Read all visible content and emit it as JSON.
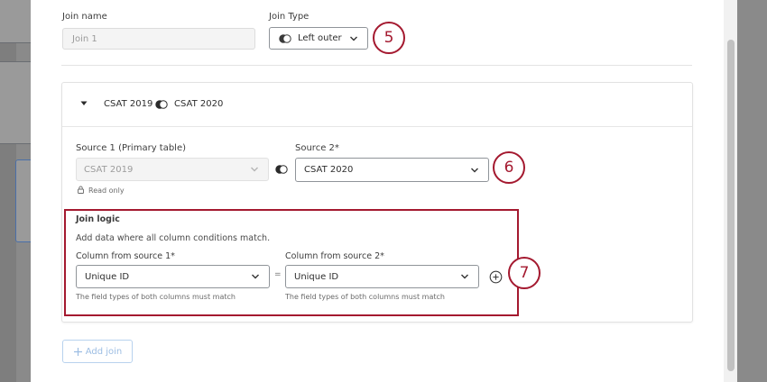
{
  "join_name": {
    "label": "Join name",
    "placeholder": "Join 1"
  },
  "join_type": {
    "label": "Join Type",
    "value": "Left outer"
  },
  "callouts": {
    "c5": "5",
    "c6": "6",
    "c7": "7"
  },
  "join_card": {
    "title_left": "CSAT 2019",
    "title_right": "CSAT 2020",
    "source1": {
      "label": "Source 1 (Primary table)",
      "value": "CSAT 2019",
      "note": "Read only"
    },
    "source2": {
      "label": "Source 2*",
      "value": "CSAT 2020"
    },
    "logic": {
      "heading": "Join logic",
      "description": "Add data where all column conditions match.",
      "col1": {
        "label": "Column from source 1*",
        "value": "Unique ID",
        "hint": "The field types of both columns must match"
      },
      "equals": "=",
      "col2": {
        "label": "Column from source 2*",
        "value": "Unique ID",
        "hint": "The field types of both columns must match"
      }
    }
  },
  "add_join_label": "Add join",
  "colors": {
    "accent": "#a4192f",
    "link": "#9cbde3"
  }
}
